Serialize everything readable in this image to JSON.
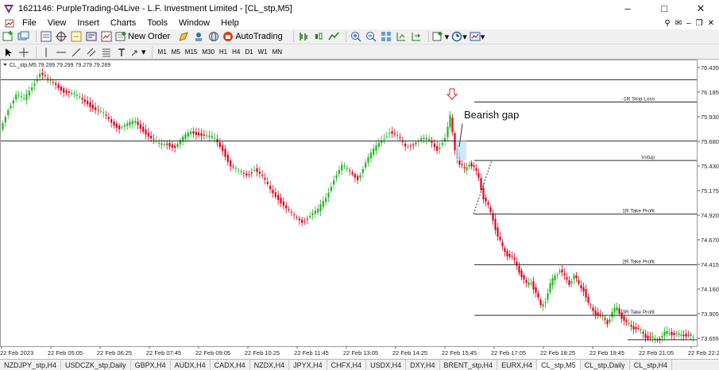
{
  "window": {
    "title": "1621146: PurpleTrading-04Live - L.F. Investment Limited - [CL_stp,M5]"
  },
  "menu": [
    "File",
    "View",
    "Insert",
    "Charts",
    "Tools",
    "Window",
    "Help"
  ],
  "toolbar": {
    "new_order": "New Order",
    "auto_trading": "AutoTrading"
  },
  "timeframes": [
    "M1",
    "M5",
    "M15",
    "M30",
    "H1",
    "H4",
    "D1",
    "W1",
    "MN"
  ],
  "chart": {
    "info": "CL_stp,M5  79.289 79.299 79.279 79.289",
    "annotation_text": "Bearish gap",
    "levels": [
      {
        "label": "-1R Stop Loss",
        "price": 76.08
      },
      {
        "label": "Vstup",
        "price": 75.48
      },
      {
        "label": "1R Take Profit",
        "price": 74.93
      },
      {
        "label": "2R Take Profit",
        "price": 74.41
      },
      {
        "label": "3R Take Profit",
        "price": 73.89
      }
    ],
    "hlines": [
      76.31,
      75.68
    ],
    "last_price_line": 73.64,
    "price_ticks": [
      "76.435",
      "76.185",
      "75.930",
      "75.680",
      "75.430",
      "75.175",
      "74.920",
      "74.670",
      "74.415",
      "74.160",
      "73.905",
      "73.655"
    ],
    "time_ticks": [
      "22 Feb 2023",
      "22 Feb 05:05",
      "22 Feb 06:25",
      "22 Feb 07:45",
      "22 Feb 09:05",
      "22 Feb 10:25",
      "22 Feb 11:45",
      "22 Feb 13:05",
      "22 Feb 14:25",
      "22 Feb 15:45",
      "22 Feb 17:05",
      "22 Feb 18:25",
      "22 Feb 19:45",
      "22 Feb 21:05",
      "22 Feb 22:25"
    ],
    "colors": {
      "bull": "#22b322",
      "bear": "#e0001c",
      "line": "#2b2b2b"
    }
  },
  "tabs": [
    "NZDJPY_stp,H4",
    "USDCZK_stp,Daily",
    "GBPX,H4",
    "AUDX,H4",
    "CADX,H4",
    "NZDX,H4",
    "JPYX,H4",
    "CHFX,H4",
    "USDX,H4",
    "DXY,H4",
    "BRENT_stp,H4",
    "EURX,H4",
    "CL_stp,M5",
    "CL_stp,Daily",
    "CL_stp,H4"
  ],
  "active_tab": "CL_stp,M5"
}
